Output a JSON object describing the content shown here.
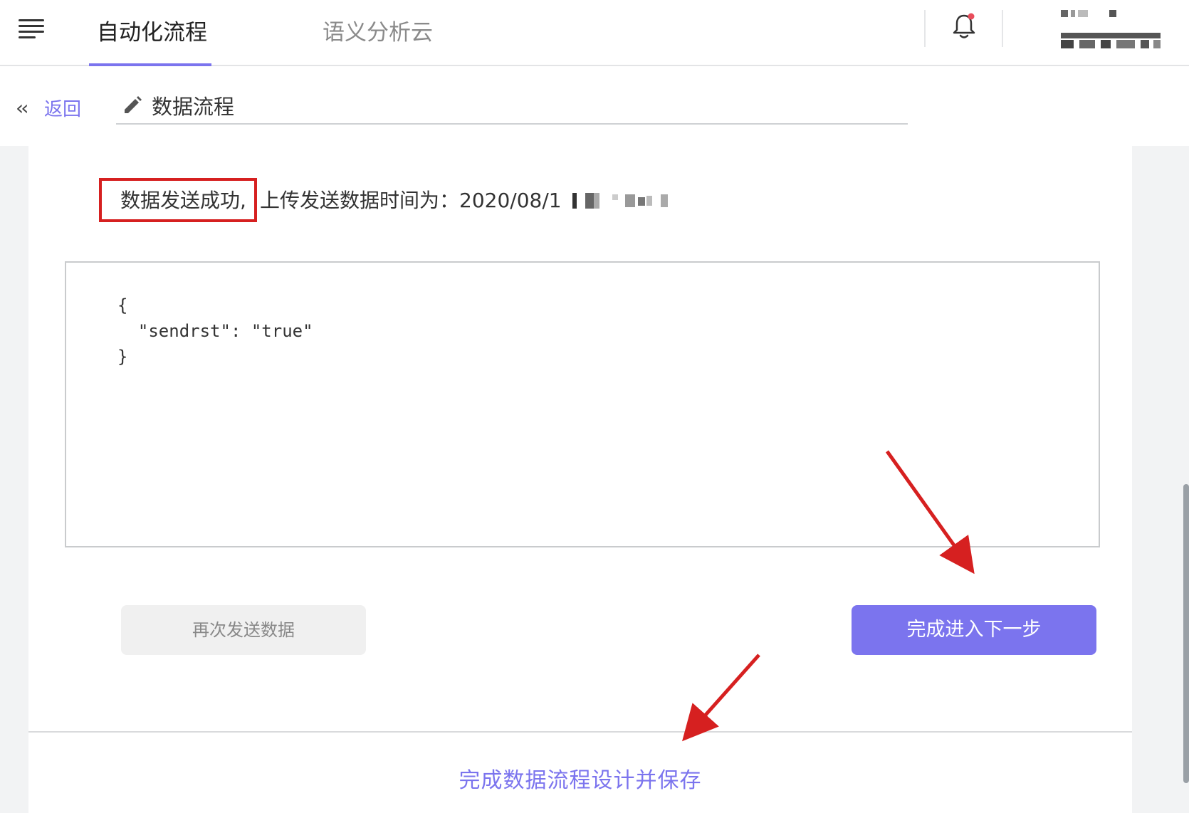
{
  "header": {
    "menu_icon": "hamburger-menu-icon",
    "tabs": [
      {
        "label": "自动化流程",
        "active": true
      },
      {
        "label": "语义分析云",
        "active": false
      }
    ],
    "notification_icon": "bell-icon",
    "notification_dot_color": "#e94d5b",
    "accent_color": "#7b74ee"
  },
  "subheader": {
    "back_icon": "double-chevron-left-icon",
    "back_label": "返回",
    "edit_icon": "pencil-icon",
    "flow_name": "数据流程"
  },
  "main": {
    "status_success": "数据发送成功,",
    "status_time": "上传发送数据时间为：2020/08/1",
    "response_json": "{\n  \"sendrst\": \"true\"\n}",
    "resend_button": "再次发送数据",
    "next_button": "完成进入下一步",
    "save_link": "完成数据流程设计并保存"
  },
  "annotations": {
    "highlight_color": "#d62020"
  }
}
